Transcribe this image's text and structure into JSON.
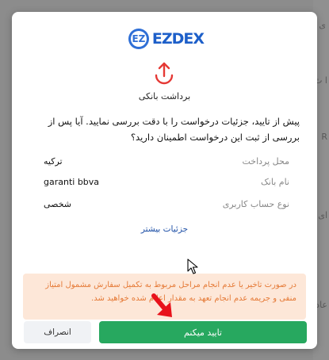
{
  "background": {
    "right_edge_text": [
      "ی",
      "ا ث",
      "R",
      "ای",
      "عاد"
    ]
  },
  "logo": {
    "mark": "EZ",
    "text": "EZDEX"
  },
  "dialog": {
    "icon": "upload-arrow-icon",
    "title": "برداشت بانکی",
    "question": "پیش از تایید، جزئیات درخواست را با دقت بررسی نمایید. آیا پس از بررسی از ثبت این درخواست اطمینان دارید؟",
    "details": [
      {
        "label": "محل پرداخت",
        "value": "ترکیه"
      },
      {
        "label": "نام بانک",
        "value": "garanti bbva"
      },
      {
        "label": "نوع حساب کاربری",
        "value": "شخصی"
      }
    ],
    "more_link": "جزئیات بیشتر",
    "warning": "در صورت تاخیر یا عدم انجام مراحل مربوط به تکمیل سفارش مشمول امتیاز منفی و جریمه عدم انجام تعهد به مقدار اعلام شده خواهید شد.",
    "confirm_label": "تایید میکنم",
    "cancel_label": "انصراف"
  },
  "colors": {
    "confirm": "#27a85f",
    "warning_bg": "#fde7d8",
    "warning_text": "#e57a37",
    "brand": "#1d5fc9",
    "icon_red": "#e53935"
  }
}
